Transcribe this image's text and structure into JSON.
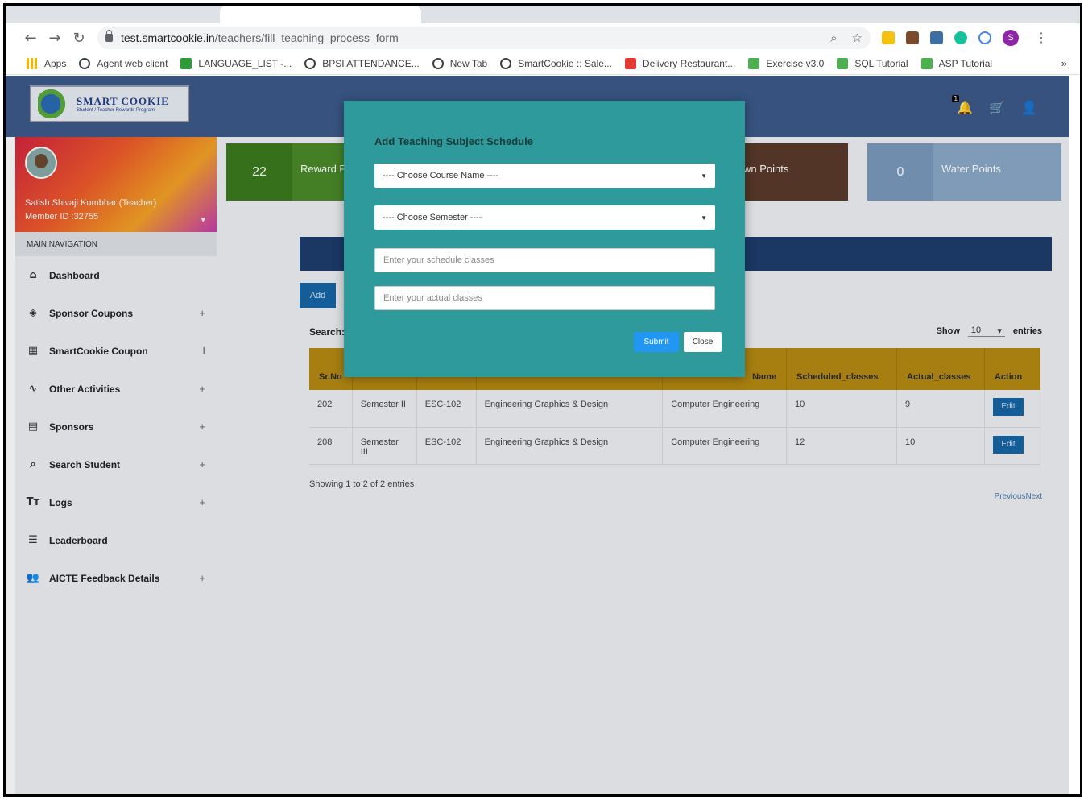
{
  "browser": {
    "url_host": "test.smartcookie.in",
    "url_path": "/teachers/fill_teaching_process_form",
    "bookmarks": [
      {
        "label": "Apps",
        "icon": "apps-icon"
      },
      {
        "label": "Agent web client",
        "icon": "globe-icon"
      },
      {
        "label": "LANGUAGE_LIST -...",
        "icon": "plus-icon"
      },
      {
        "label": "BPSI ATTENDANCE...",
        "icon": "globe-icon"
      },
      {
        "label": "New Tab",
        "icon": "globe-icon"
      },
      {
        "label": "SmartCookie :: Sale...",
        "icon": "globe-icon"
      },
      {
        "label": "Delivery Restaurant...",
        "icon": "delivery-icon"
      },
      {
        "label": "Exercise v3.0",
        "icon": "w3-icon"
      },
      {
        "label": "SQL Tutorial",
        "icon": "w3-icon"
      },
      {
        "label": "ASP Tutorial",
        "icon": "w3-icon"
      }
    ],
    "more": "»",
    "profile_initial": "S"
  },
  "app": {
    "logo_title": "SMART COOKIE",
    "logo_subtitle": "Student / Teacher Rewards Program",
    "notification_count": "1"
  },
  "user": {
    "name": "Satish Shivaji Kumbhar (Teacher)",
    "member_id": "Member ID :32755"
  },
  "sidebar": {
    "heading": "MAIN NAVIGATION",
    "items": [
      {
        "label": "Dashboard",
        "icon": "home-icon",
        "expand": ""
      },
      {
        "label": "Sponsor Coupons",
        "icon": "layers-icon",
        "expand": "+"
      },
      {
        "label": "SmartCookie Coupon",
        "icon": "grid-icon",
        "expand": "I"
      },
      {
        "label": "Other Activities",
        "icon": "activity-icon",
        "expand": "+"
      },
      {
        "label": "Sponsors",
        "icon": "clipboard-icon",
        "expand": "+"
      },
      {
        "label": "Search Student",
        "icon": "search-icon",
        "expand": "+"
      },
      {
        "label": "Logs",
        "icon": "text-icon",
        "expand": "+"
      },
      {
        "label": "Leaderboard",
        "icon": "list-icon",
        "expand": ""
      },
      {
        "label": "AICTE Feedback Details",
        "icon": "users-icon",
        "expand": "+"
      }
    ]
  },
  "cards": {
    "reward": {
      "value": "22",
      "label": "Reward P"
    },
    "brown": {
      "label": "wn Points"
    },
    "water": {
      "value": "0",
      "label": "Water Points"
    }
  },
  "content": {
    "add_label": "Add",
    "search_label": "Search:",
    "show_label": "Show",
    "show_value": "10",
    "entries_label": "entries",
    "columns": [
      "Sr.No",
      "",
      "",
      "",
      "Name",
      "Scheduled_classes",
      "Actual_classes",
      "Action"
    ],
    "rows": [
      {
        "srno": "202",
        "semester": "Semester II",
        "code": "ESC-102",
        "subject": "Engineering Graphics & Design",
        "dept": "Computer Engineering",
        "scheduled": "10",
        "actual": "9",
        "action": "Edit"
      },
      {
        "srno": "208",
        "semester": "Semester III",
        "code": "ESC-102",
        "subject": "Engineering Graphics & Design",
        "dept": "Computer Engineering",
        "scheduled": "12",
        "actual": "10",
        "action": "Edit"
      }
    ],
    "showing": "Showing 1 to 2 of 2 entries",
    "pager": "PreviousNext"
  },
  "modal": {
    "title": "Add Teaching Subject Schedule",
    "course_select": "---- Choose Course Name ----",
    "semester_select": "---- Choose Semester ----",
    "schedule_placeholder": "Enter your schedule classes",
    "actual_placeholder": "Enter your actual classes",
    "submit_label": "Submit",
    "close_label": "Close"
  }
}
